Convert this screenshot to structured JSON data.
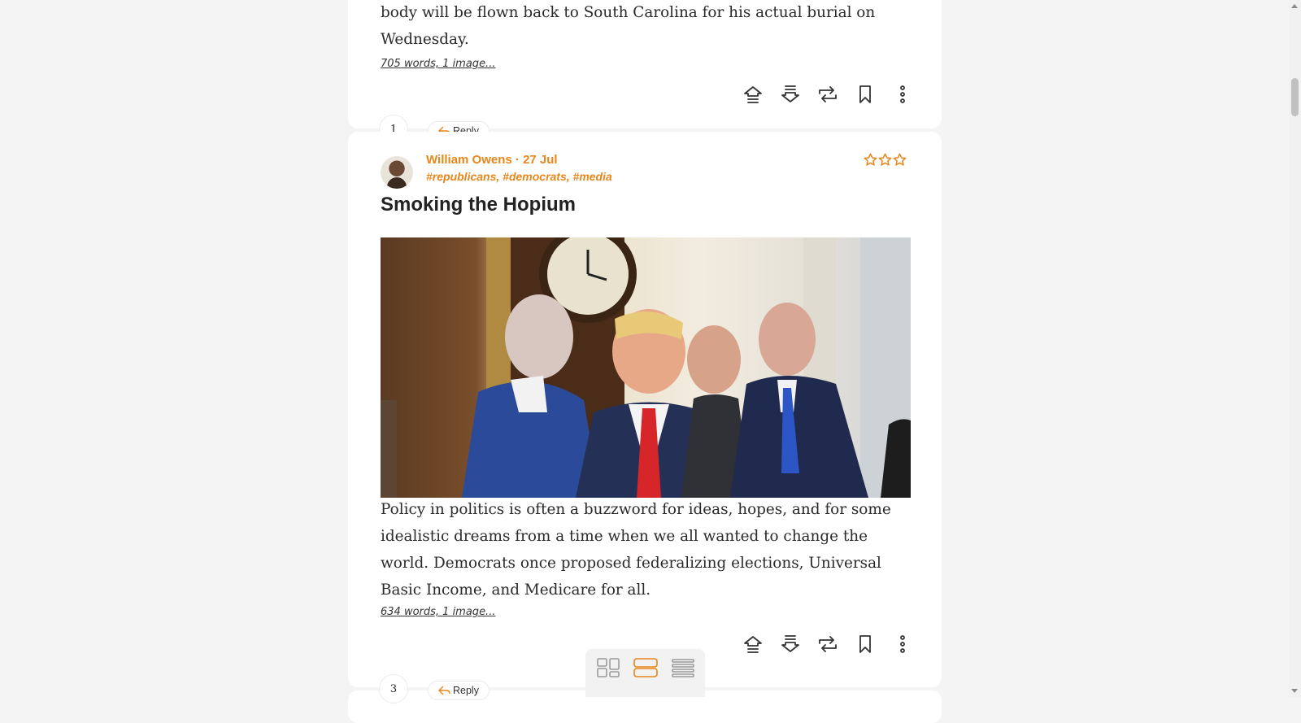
{
  "post1": {
    "excerpt": "body will be flown back to South Carolina for his actual burial on Wednesday.",
    "wordcount": "705 words, 1 image..."
  },
  "post2": {
    "author": "William Owens",
    "date": "· 27 Jul",
    "tags": [
      "#republicans",
      "#democrats",
      "#media"
    ],
    "title": "Smoking the Hopium",
    "excerpt": "Policy in politics is often a buzzword for ideas, hopes, and for some idealistic dreams from a time when we all wanted to change the world. Democrats once proposed federalizing elections, Universal Basic Income, and Medicare for all.",
    "wordcount": "634 words, 1 image..."
  },
  "thread1": {
    "count": "1",
    "reply_label": "Reply"
  },
  "thread2": {
    "count": "3",
    "reply_label": "Reply"
  },
  "icons": {
    "actions": [
      "upvote-icon",
      "downvote-icon",
      "repost-icon",
      "bookmark-icon",
      "more-icon"
    ],
    "view_modes": [
      "grid-view-icon",
      "card-view-icon",
      "list-view-icon"
    ],
    "rating": [
      "star-icon",
      "star-icon",
      "star-icon"
    ]
  },
  "colors": {
    "accent": "#e8861a",
    "background": "#f4f4f5",
    "card": "#ffffff",
    "text": "#222222"
  },
  "view_switch": {
    "active": "card-view"
  }
}
